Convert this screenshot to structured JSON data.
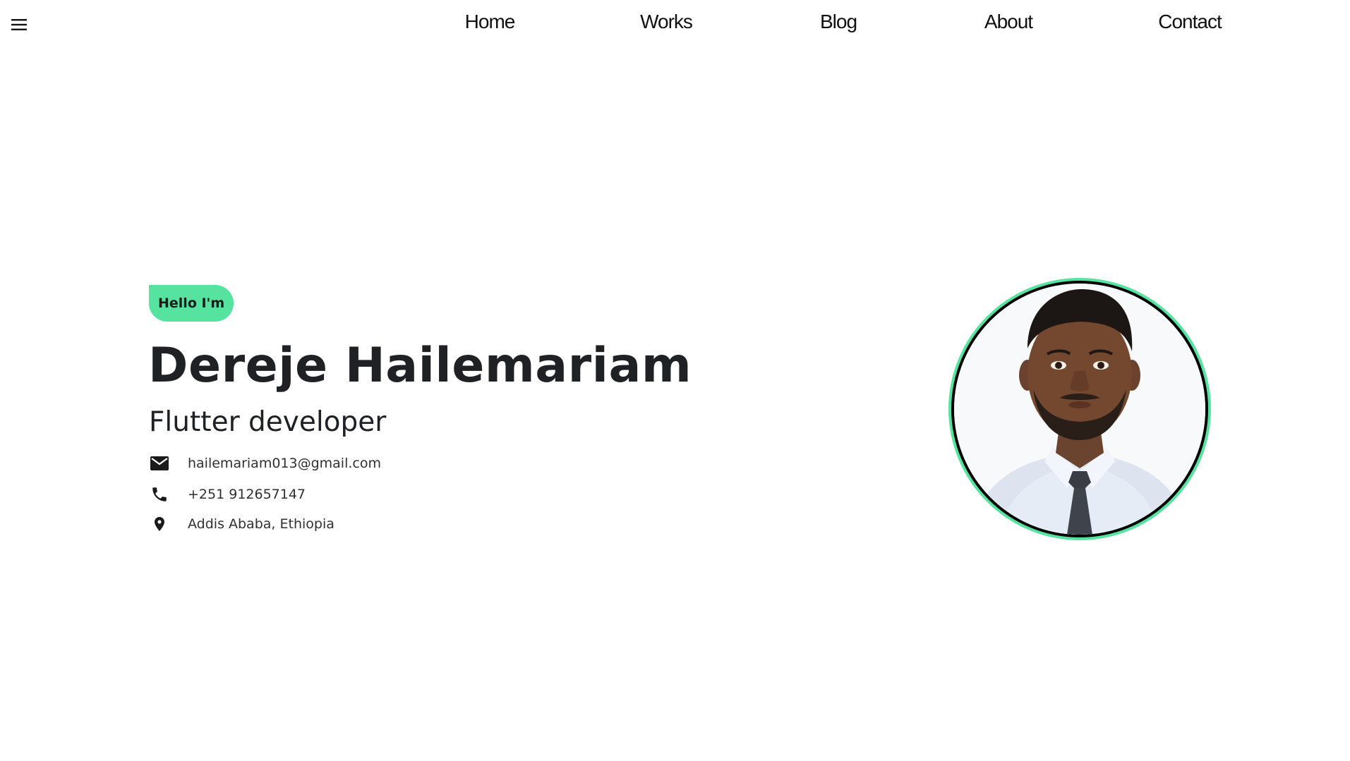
{
  "nav": {
    "menu_icon": "hamburger-menu-icon",
    "links": [
      "Home",
      "Works",
      "Blog",
      "About",
      "Contact"
    ]
  },
  "hero": {
    "greeting": "Hello I'm",
    "name": "Dereje Hailemariam",
    "role": "Flutter developer",
    "contacts": {
      "email": {
        "icon": "email-icon",
        "text": "hailemariam013@gmail.com"
      },
      "phone": {
        "icon": "phone-icon",
        "text": "+251 912657147"
      },
      "location": {
        "icon": "location-pin-icon",
        "text": "Addis Ababa, Ethiopia"
      }
    },
    "avatar_alt": "profile photo"
  },
  "colors": {
    "accent": "#56e39f",
    "text": "#202124",
    "background": "#ffffff"
  }
}
